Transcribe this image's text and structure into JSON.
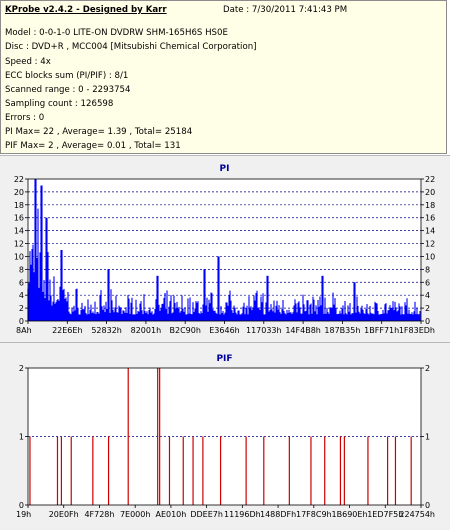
{
  "info": {
    "title": "KProbe v2.4.2 - Designed by Karr",
    "date": "Date : 7/30/2011 7:41:43 PM",
    "lines": [
      "Model : 0-0-1-0 LITE-ON DVDRW SHM-165H6S HS0E",
      "Disc : DVD+R , MCC004 [Mitsubishi Chemical Corporation]",
      "Speed : 4x",
      "ECC blocks sum (PI/PIF) : 8/1",
      "Scanned range : 0 - 2293754",
      "Sampling count : 126598",
      "Errors : 0",
      "PI Max= 22 , Average= 1.39 , Total= 25184",
      "PIF Max= 2 , Average= 0.01 , Total= 131"
    ]
  },
  "colors": {
    "pi": "#0000ff",
    "pif": "#cc0000",
    "title": "#0000a0",
    "grid": "#000080"
  },
  "chart_data": [
    {
      "type": "bar",
      "title": "PI",
      "ylim": [
        0,
        22
      ],
      "y_ticks": [
        0,
        2,
        4,
        6,
        8,
        10,
        12,
        14,
        16,
        18,
        20,
        22
      ],
      "x_tick_labels": [
        "8Ah",
        "22E6Eh",
        "52832h",
        "82001h",
        "B2C90h",
        "E3646h",
        "117033h",
        "14F4B8h",
        "187B35h",
        "1BFF71h",
        "1F83EDh"
      ],
      "grid": "dashed horizontal",
      "segments": [
        {
          "from": 0.0,
          "to": 0.012,
          "min": 5,
          "max": 20
        },
        {
          "from": 0.012,
          "to": 0.03,
          "min": 4,
          "max": 22
        },
        {
          "from": 0.03,
          "to": 0.06,
          "min": 3,
          "max": 15
        },
        {
          "from": 0.06,
          "to": 0.1,
          "min": 2,
          "max": 10
        },
        {
          "from": 0.1,
          "to": 0.14,
          "min": 1,
          "max": 6
        },
        {
          "from": 0.14,
          "to": 0.3,
          "min": 1,
          "max": 5
        },
        {
          "from": 0.3,
          "to": 0.45,
          "min": 1,
          "max": 5
        },
        {
          "from": 0.45,
          "to": 0.6,
          "min": 1,
          "max": 6
        },
        {
          "from": 0.6,
          "to": 0.8,
          "min": 1,
          "max": 5
        },
        {
          "from": 0.8,
          "to": 1.0,
          "min": 1,
          "max": 4
        }
      ],
      "spikes": [
        [
          0.02,
          22
        ],
        [
          0.035,
          21
        ],
        [
          0.048,
          16
        ],
        [
          0.085,
          11
        ],
        [
          0.205,
          8
        ],
        [
          0.33,
          7
        ],
        [
          0.45,
          8
        ],
        [
          0.485,
          10
        ],
        [
          0.61,
          7
        ],
        [
          0.75,
          7
        ],
        [
          0.83,
          6
        ]
      ]
    },
    {
      "type": "bar",
      "title": "PIF",
      "ylim": [
        0,
        2
      ],
      "y_ticks": [
        0,
        1,
        2
      ],
      "x_tick_labels": [
        "19h",
        "20E0Fh",
        "4F728h",
        "7E000h",
        "AE010h",
        "DDEE7h",
        "11196Dh",
        "1488DFh",
        "17F8C9h",
        "1B690Eh",
        "1ED7F5h",
        "224754h"
      ],
      "grid": "dashed horizontal",
      "bars": [
        [
          0.005,
          1
        ],
        [
          0.075,
          1
        ],
        [
          0.085,
          1
        ],
        [
          0.11,
          1
        ],
        [
          0.165,
          1
        ],
        [
          0.205,
          1
        ],
        [
          0.255,
          2
        ],
        [
          0.33,
          2
        ],
        [
          0.335,
          2
        ],
        [
          0.36,
          1
        ],
        [
          0.395,
          1
        ],
        [
          0.42,
          1
        ],
        [
          0.445,
          1
        ],
        [
          0.49,
          1
        ],
        [
          0.555,
          1
        ],
        [
          0.6,
          1
        ],
        [
          0.665,
          1
        ],
        [
          0.72,
          1
        ],
        [
          0.755,
          1
        ],
        [
          0.795,
          1
        ],
        [
          0.805,
          1
        ],
        [
          0.865,
          1
        ],
        [
          0.915,
          1
        ],
        [
          0.935,
          1
        ],
        [
          0.975,
          1
        ]
      ]
    }
  ]
}
